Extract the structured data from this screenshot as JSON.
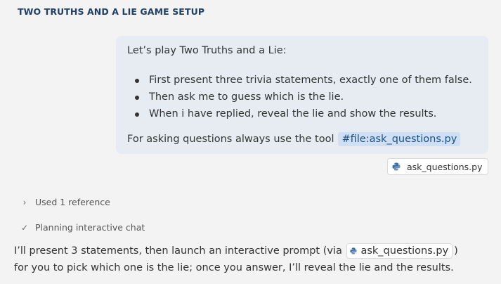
{
  "header": {
    "title": "TWO TRUTHS AND A LIE GAME SETUP"
  },
  "user_message": {
    "intro": "Let’s play Two Truths and a Lie:",
    "bullets": [
      "First present three trivia statements, exactly one of them false.",
      "Then ask me to guess which is the lie.",
      "When i have replied, reveal the lie and show the results."
    ],
    "tool_line_prefix": "For asking questions always use the tool",
    "tool_reference": "#file:ask_questions.py"
  },
  "attachment": {
    "label": "ask_questions.py",
    "icon": "python-file-icon"
  },
  "status": {
    "references": {
      "label": "Used 1 reference",
      "icon": "chevron-right-icon"
    },
    "planning": {
      "label": "Planning interactive chat",
      "icon": "checkmark-icon"
    }
  },
  "assistant_reply": {
    "part1": "I’ll present 3 statements, then launch an interactive prompt (via",
    "file_chip": "ask_questions.py",
    "part2": ")",
    "part3": "for you to pick which one is the lie; once you answer, I’ll reveal the lie and the results."
  },
  "colors": {
    "background": "#f3f3f3",
    "header": "#1f3f66",
    "bubble": "#e6ecf2",
    "file_reference_bg": "#cfe0f5",
    "file_reference_text": "#1a4f87"
  }
}
